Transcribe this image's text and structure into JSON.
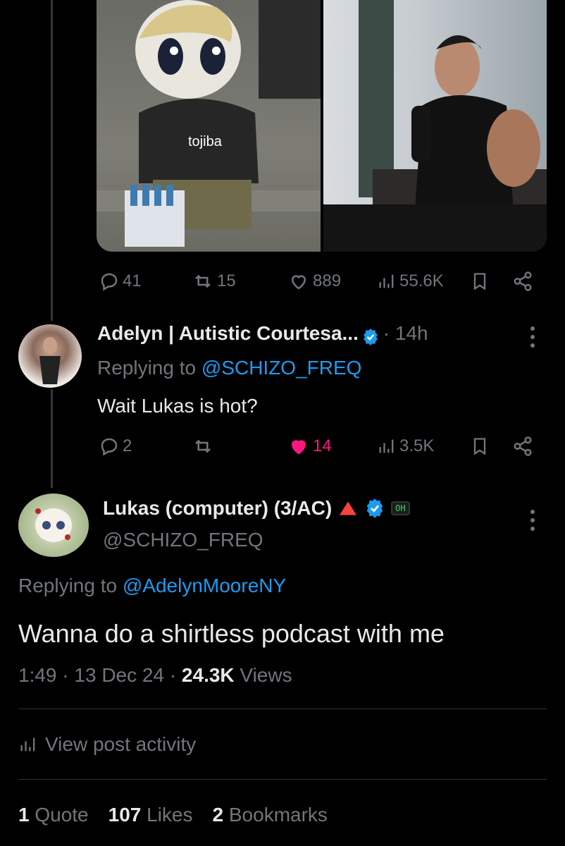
{
  "parent_tweet": {
    "media_caption": "tojiba",
    "replies": "41",
    "reposts": "15",
    "likes": "889",
    "views": "55.6K"
  },
  "reply": {
    "display_name": "Adelyn | Autistic Courtesa...",
    "time": "· 14h",
    "replying_prefix": "Replying to ",
    "replying_handle": "@SCHIZO_FREQ",
    "text": "Wait Lukas is hot?",
    "replies": "2",
    "likes": "14",
    "views": "3.5K"
  },
  "main_tweet": {
    "display_name": "Lukas (computer) (3/AC)",
    "badge_text": "OH",
    "handle": "@SCHIZO_FREQ",
    "replying_prefix": "Replying to ",
    "replying_handle": "@AdelynMooreNY",
    "text": "Wanna do a shirtless podcast with me",
    "time": "1:49",
    "date": "13 Dec 24",
    "views_count": "24.3K",
    "views_label": " Views",
    "activity_label": "View post activity",
    "quotes_count": "1",
    "quotes_label": " Quote",
    "likes_count": "107",
    "likes_label": " Likes",
    "bookmarks_count": "2",
    "bookmarks_label": " Bookmarks"
  },
  "colors": {
    "accent": "#1d9bf0",
    "like": "#f91880",
    "muted": "#71767b",
    "bg": "#000000"
  }
}
